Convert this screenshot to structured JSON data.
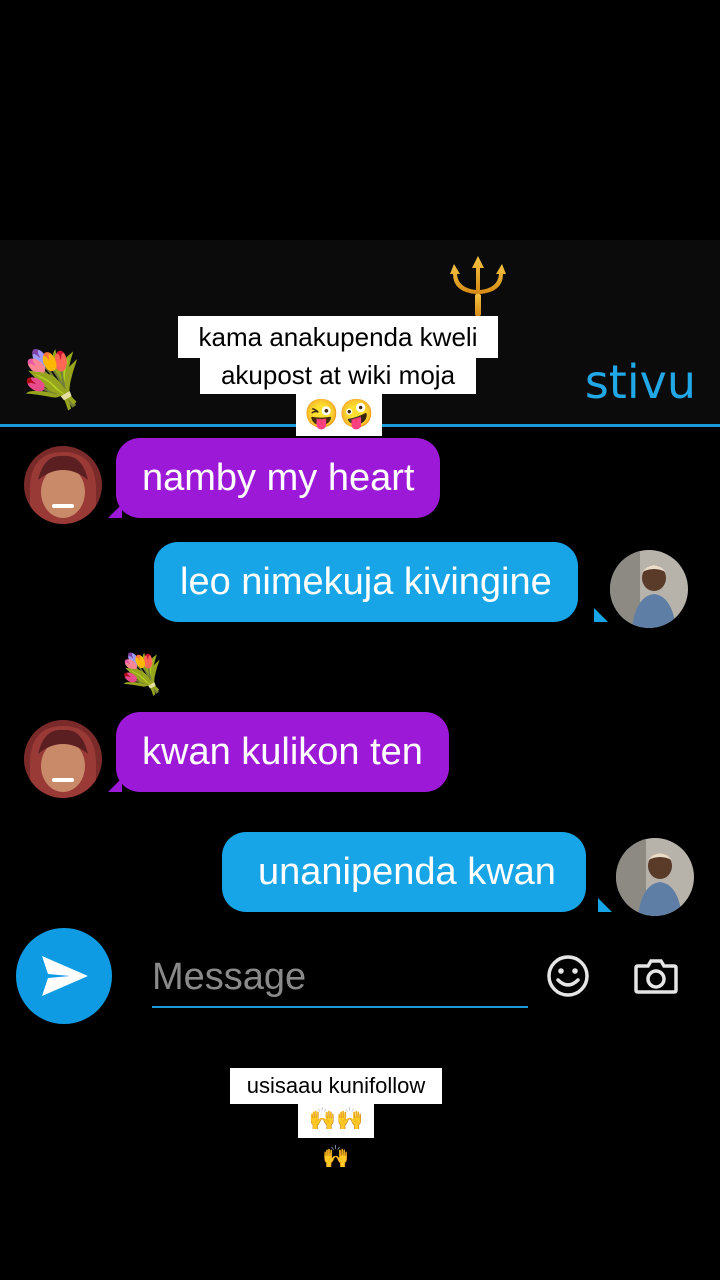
{
  "header": {
    "contact_name": "stivu",
    "flower": "💐",
    "trident_icon": "trident-icon"
  },
  "overlay_top": {
    "line1": "kama anakupenda kweli",
    "line2": "akupost at wiki moja",
    "line3": "😜🤪"
  },
  "messages": [
    {
      "side": "incoming",
      "text": "namby my heart"
    },
    {
      "side": "outgoing",
      "text": "leo nimekuja kivingine"
    },
    {
      "side": "incoming",
      "text": "kwan kulikon ten"
    },
    {
      "side": "outgoing",
      "text": "unanipenda kwan"
    }
  ],
  "chat_flower": "💐",
  "composer": {
    "placeholder": "Message",
    "value": "",
    "send_icon": "send-icon",
    "emoji_icon": "emoji-icon",
    "camera_icon": "camera-icon"
  },
  "overlay_bottom": {
    "line1": "usisaau kunifollow",
    "line2": "🙌🙌🙌"
  },
  "colors": {
    "incoming_bubble": "#9c19d8",
    "outgoing_bubble": "#17a5e8",
    "accent": "#1a9ad8"
  }
}
